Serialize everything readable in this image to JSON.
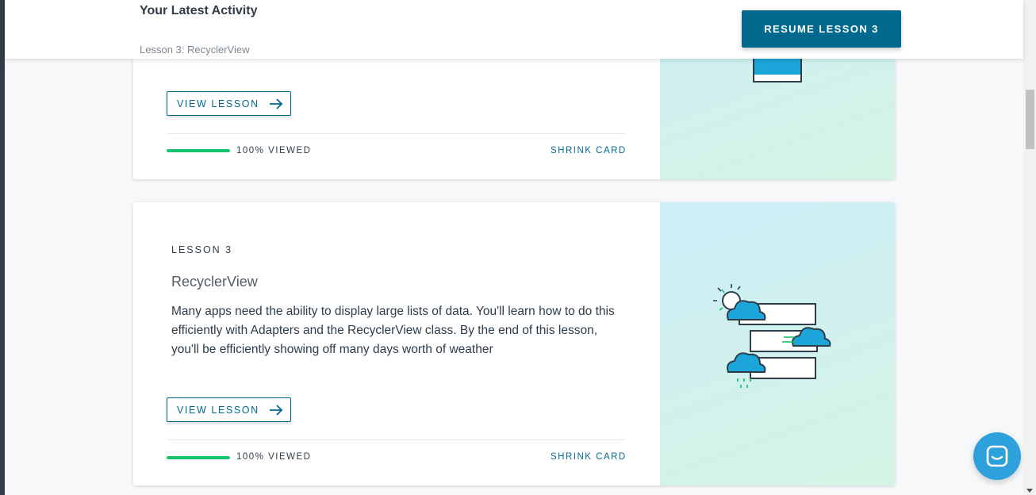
{
  "activity": {
    "title": "Your Latest Activity",
    "subtitle": "Lesson 3: RecyclerView",
    "resume_label": "RESUME LESSON 3"
  },
  "cards": [
    {
      "view_label": "VIEW LESSON",
      "progress_text": "100% VIEWED",
      "progress_fraction": 1.0,
      "shrink_label": "SHRINK CARD"
    },
    {
      "lesson_label": "LESSON 3",
      "title": "RecyclerView",
      "description": "Many apps need the ability to display large lists of data. You'll learn how to do this efficiently with Adapters and the RecyclerView class. By the end of this lesson, you'll be efficiently showing off many days worth of weather",
      "view_label": "VIEW LESSON",
      "progress_text": "100% VIEWED",
      "progress_fraction": 1.0,
      "shrink_label": "SHRINK CARD"
    }
  ],
  "colors": {
    "accent": "#02698e",
    "progress": "#15c26b",
    "chat": "#2ea1dc"
  },
  "icons": [
    "arrow-right-icon",
    "chat-icon",
    "weather-list-illustration",
    "phone-illustration"
  ]
}
